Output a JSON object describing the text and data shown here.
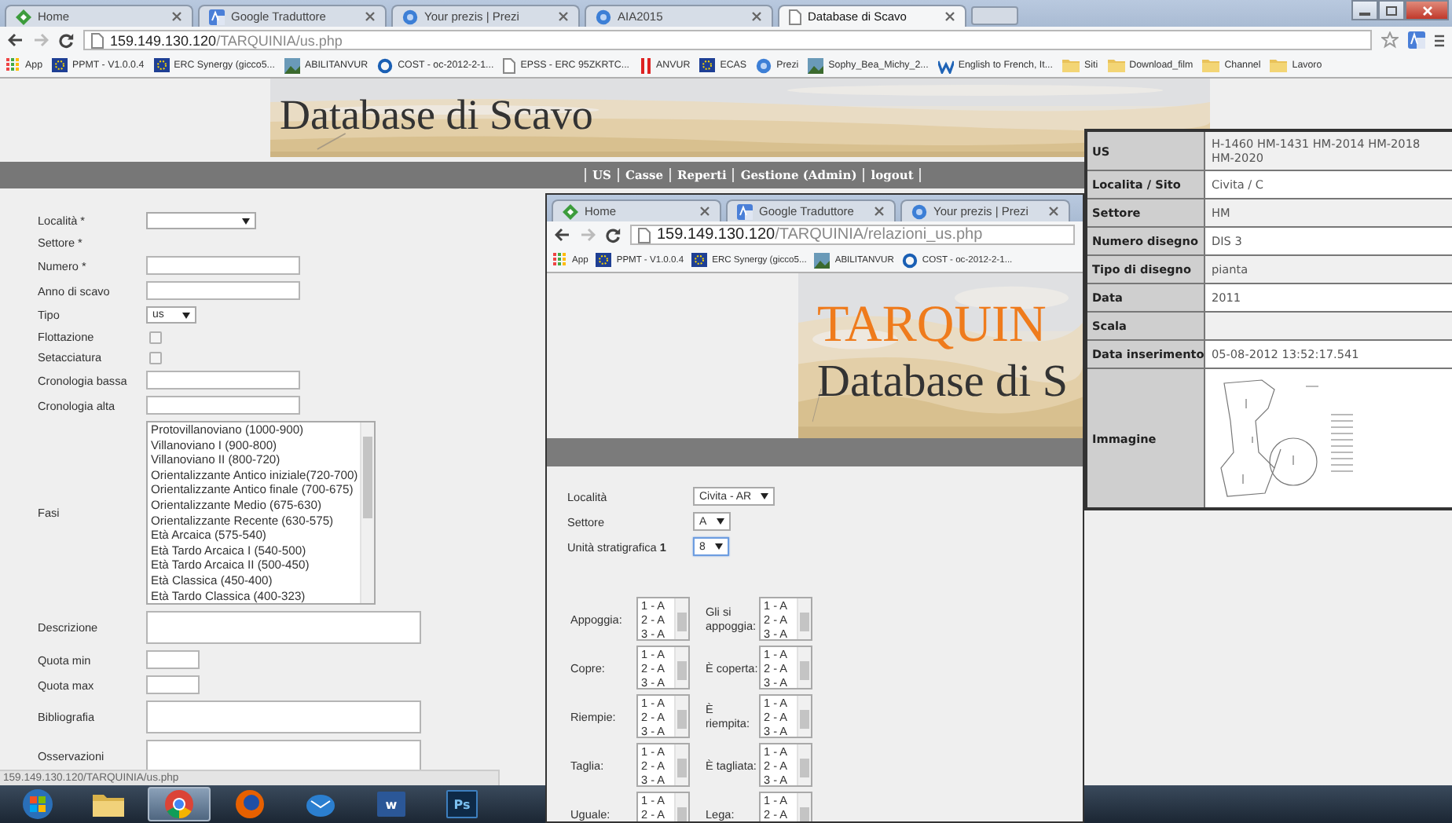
{
  "main_browser": {
    "tabs": [
      {
        "label": "Home",
        "selected": false
      },
      {
        "label": "Google Traduttore",
        "selected": false
      },
      {
        "label": "Your prezis | Prezi",
        "selected": false
      },
      {
        "label": "AIA2015",
        "selected": false
      },
      {
        "label": "Database di Scavo",
        "selected": true
      }
    ],
    "address": {
      "host": "159.149.130.120",
      "path": "/TARQUINIA/us.php"
    },
    "bookmarks": [
      "App",
      "PPMT - V1.0.0.4",
      "ERC Synergy (gicco5...",
      "ABILITANVUR",
      "COST - oc-2012-2-1...",
      "EPSS - ERC 95ZKRTC...",
      "ANVUR",
      "ECAS",
      "Prezi",
      "Sophy_Bea_Michy_2...",
      "English to French, It...",
      "Siti",
      "Download_film",
      "Channel",
      "Lavoro"
    ],
    "page": {
      "title": "Database di Scavo",
      "nav": [
        "US",
        "Casse",
        "Reperti",
        "Gestione (Admin)",
        "logout"
      ],
      "form": [
        {
          "kind": "select",
          "label": "Località *"
        },
        {
          "kind": "label",
          "label": "Settore *"
        },
        {
          "kind": "input",
          "label": "Numero *"
        },
        {
          "kind": "input",
          "label": "Anno di scavo"
        },
        {
          "kind": "select",
          "label": "Tipo",
          "value": "us"
        },
        {
          "kind": "checkbox",
          "label": "Flottazione",
          "checked": false
        },
        {
          "kind": "checkbox",
          "label": "Setacciatura",
          "checked": false
        },
        {
          "kind": "input",
          "label": "Cronologia bassa"
        },
        {
          "kind": "input",
          "label": "Cronologia alta"
        },
        {
          "kind": "listbox",
          "label": "Fasi",
          "options": [
            "Protovillanoviano (1000-900)",
            "Villanoviano I (900-800)",
            "Villanoviano II (800-720)",
            "Orientalizzante Antico iniziale(720-700)",
            "Orientalizzante Antico finale (700-675)",
            "Orientalizzante Medio (675-630)",
            "Orientalizzante Recente (630-575)",
            "Età Arcaica (575-540)",
            "Età Tardo Arcaica I (540-500)",
            "Età Tardo Arcaica II (500-450)",
            "Età Classica (450-400)",
            "Età Tardo Classica (400-323)"
          ]
        },
        {
          "kind": "textarea",
          "label": "Descrizione"
        },
        {
          "kind": "short",
          "label": "Quota min"
        },
        {
          "kind": "short",
          "label": "Quota max"
        },
        {
          "kind": "textarea",
          "label": "Bibliografia"
        },
        {
          "kind": "textarea",
          "label": "Osservazioni"
        }
      ]
    }
  },
  "status_url": "159.149.130.120/TARQUINIA/us.php",
  "taskbar": [
    {
      "kind": "start",
      "selected": false
    },
    {
      "kind": "folder",
      "selected": false
    },
    {
      "kind": "chrome",
      "selected": true
    },
    {
      "kind": "firefox",
      "selected": false
    },
    {
      "kind": "mail",
      "selected": false
    },
    {
      "kind": "word",
      "label": "w",
      "selected": false
    },
    {
      "kind": "photoshop",
      "label": "Ps",
      "selected": false
    }
  ],
  "relations_window": {
    "tabs": [
      {
        "label": "Home",
        "selected": false
      },
      {
        "label": "Google Traduttore",
        "selected": false
      },
      {
        "label": "Your prezis | Prezi",
        "selected": false
      }
    ],
    "address": {
      "host": "159.149.130.120",
      "path": "/TARQUINIA/relazioni_us.php"
    },
    "bookmarks": [
      "App",
      "PPMT - V1.0.0.4",
      "ERC Synergy (gicco5...",
      "ABILITANVUR",
      "COST - oc-2012-2-1..."
    ],
    "page": {
      "title": "TARQUIN",
      "subtitle": "Database di S",
      "fields": [
        {
          "label": "Località",
          "value": "Civita - AR",
          "focused": false
        },
        {
          "label": "Settore",
          "value": "A",
          "focused": false
        },
        {
          "label": "Unità stratigrafica **1**",
          "value": "8",
          "focused": true
        }
      ],
      "relations": [
        {
          "label": "Appoggia:",
          "options": [
            "1 - A",
            "2 - A",
            "3 - A"
          ]
        },
        {
          "label": "Gli si appoggia:",
          "options": [
            "1 - A",
            "2 - A",
            "3 - A"
          ]
        },
        {
          "label": "Copre:",
          "options": [
            "1 - A",
            "2 - A",
            "3 - A"
          ]
        },
        {
          "label": "È coperta:",
          "options": [
            "1 - A",
            "2 - A",
            "3 - A"
          ]
        },
        {
          "label": "Riempie:",
          "options": [
            "1 - A",
            "2 - A",
            "3 - A"
          ]
        },
        {
          "label": "È riempita:",
          "options": [
            "1 - A",
            "2 - A",
            "3 - A"
          ]
        },
        {
          "label": "Taglia:",
          "options": [
            "1 - A",
            "2 - A",
            "3 - A"
          ]
        },
        {
          "label": "È tagliata:",
          "options": [
            "1 - A",
            "2 - A",
            "3 - A"
          ]
        },
        {
          "label": "Uguale:",
          "options": [
            "1 - A",
            "2 - A"
          ]
        },
        {
          "label": "Lega:",
          "options": [
            "1 - A",
            "2 - A"
          ]
        }
      ]
    }
  },
  "record_panel": {
    "rows": [
      {
        "label": "US",
        "value": "H-1460  HM-1431  HM-2014  HM-2018  HM-2020"
      },
      {
        "label": "Localita / Sito",
        "value": "Civita / C"
      },
      {
        "label": "Settore",
        "value": "HM"
      },
      {
        "label": "Numero disegno",
        "value": "DIS 3"
      },
      {
        "label": "Tipo di disegno",
        "value": "pianta"
      },
      {
        "label": "Data",
        "value": "2011"
      },
      {
        "label": "Scala"
      },
      {
        "label": "Data inserimento",
        "value": "05-08-2012 13:52:17.541"
      },
      {
        "label": "Immagine",
        "kind": "drawing"
      }
    ]
  }
}
